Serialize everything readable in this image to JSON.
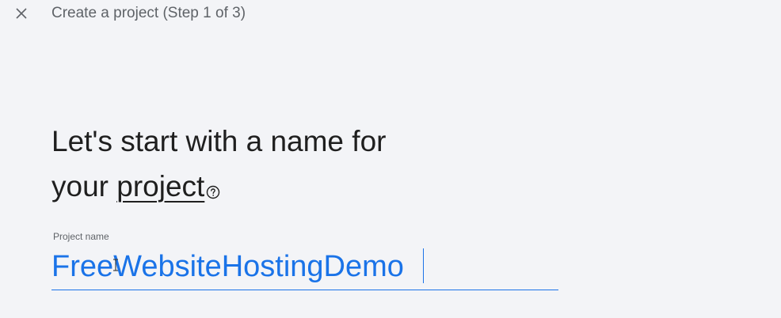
{
  "header": {
    "close_icon": "close-icon",
    "title": "Create a project (Step 1 of 3)"
  },
  "main": {
    "heading": {
      "line1": "Let's start with a name for",
      "line2_prefix": "your ",
      "line2_link": "project"
    },
    "help_icon": "help-circle-icon",
    "field": {
      "label": "Project name",
      "value": "FreeWebsiteHostingDemo",
      "placeholder": ""
    }
  },
  "colors": {
    "background": "#f3f4f7",
    "accent": "#1a73e8",
    "muted_text": "#5f6368",
    "heading_text": "#1f1f1f"
  }
}
